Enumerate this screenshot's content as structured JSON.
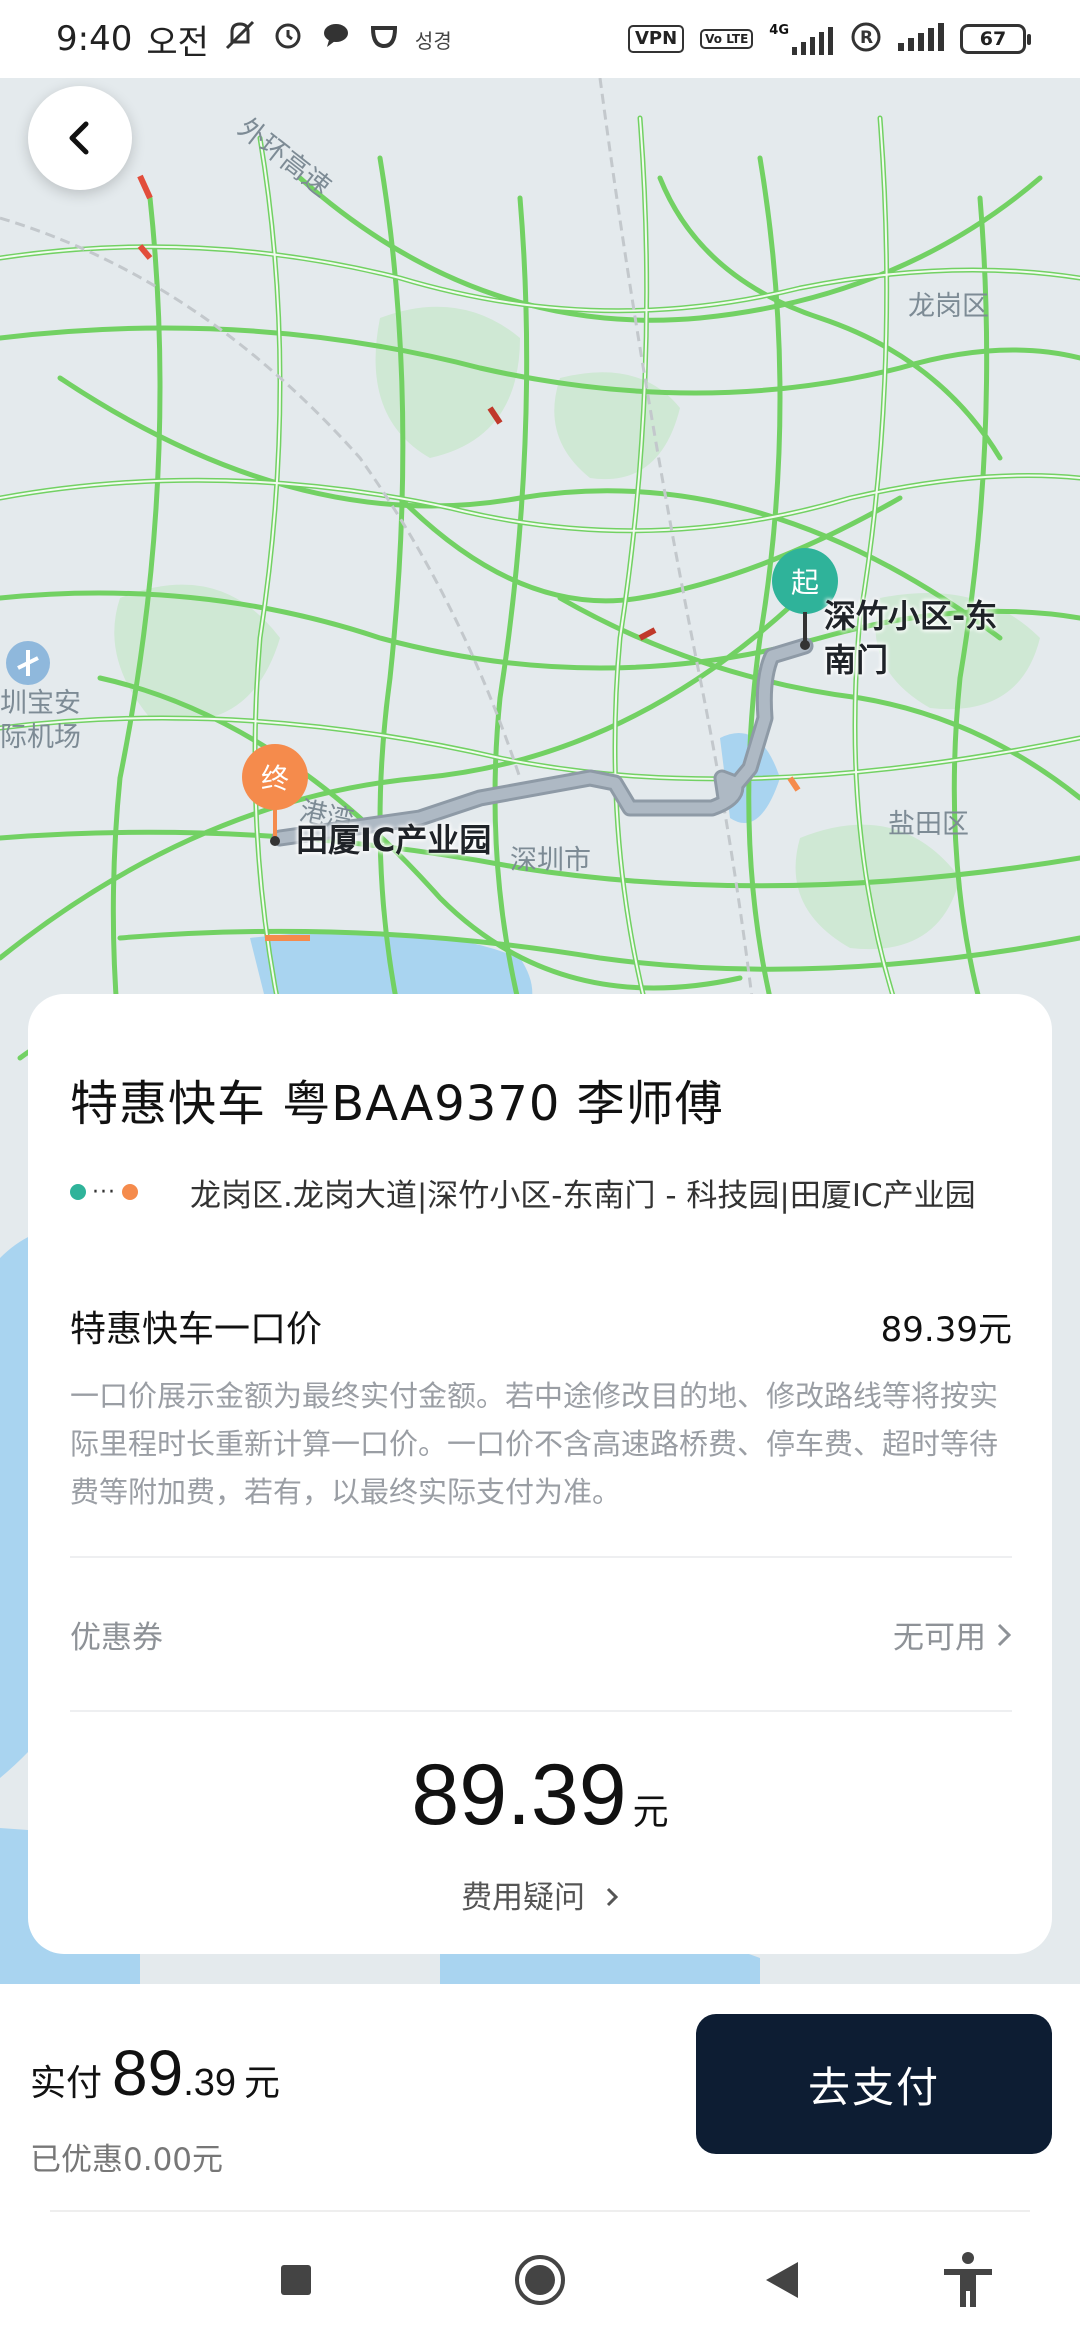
{
  "status_bar": {
    "time": "9:40",
    "ampm": "오전",
    "carrier_note": "성경",
    "vpn": "VPN",
    "volte": "Vo LTE",
    "network": "4G",
    "battery": "67"
  },
  "map": {
    "district_longgang": "龙岗区",
    "district_yantian": "盐田区",
    "city_label": "深圳市",
    "airport_label_1": "圳宝安",
    "airport_label_2": "际机场",
    "road_label_top": "外环高速",
    "road_label_bottom": "港湾",
    "start_marker": "起",
    "end_marker": "终",
    "start_place_line1": "深竹小区-东",
    "start_place_line2": "南门",
    "end_place": "田厦IC产业园",
    "colors": {
      "road": "#72d163",
      "route": "#a9b4bf",
      "start": "#2fb39a",
      "end": "#f58b4c"
    }
  },
  "card": {
    "title": "特惠快车  粤BAA9370  李师傅",
    "route_text": "龙岗区.龙岗大道|深竹小区-东南门 - 科技园|田厦IC产业园",
    "price_label": "特惠快车一口价",
    "price_amount": "89.39元",
    "description": "一口价展示金额为最终实付金额。若中途修改目的地、修改路线等将按实际里程时长重新计算一口价。一口价不含高速路桥费、停车费、超时等待费等附加费，若有，以最终实际支付为准。",
    "coupon_label": "优惠券",
    "coupon_value": "无可用",
    "total_amount": "89.39",
    "total_unit": "元",
    "fee_question": "费用疑问"
  },
  "bottom": {
    "pay_prefix": "实付",
    "pay_int": "89",
    "pay_dec": ".39",
    "pay_unit": "元",
    "discount": "已优惠0.00元",
    "pay_button": "去支付",
    "pay_button_color": "#0d1d33"
  },
  "nav": {
    "icons": [
      "recents-square-icon",
      "home-circle-icon",
      "back-triangle-icon",
      "accessibility-icon"
    ]
  }
}
